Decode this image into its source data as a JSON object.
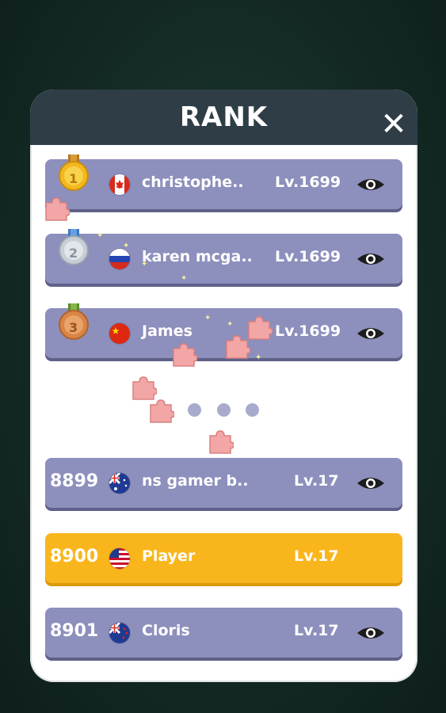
{
  "panel": {
    "title": "RANK"
  },
  "close_glyph": "✕",
  "rows": [
    {
      "rank": "1",
      "medal": "gold",
      "flag": "canada",
      "name": "christophe..",
      "level": "Lv.1699"
    },
    {
      "rank": "2",
      "medal": "silver",
      "flag": "russia",
      "name": "karen mcga..",
      "level": "Lv.1699"
    },
    {
      "rank": "3",
      "medal": "bronze",
      "flag": "china",
      "name": "James",
      "level": "Lv.1699"
    },
    {
      "rank": "8899",
      "flag": "australia",
      "name": "ns gamer b..",
      "level": "Lv.17"
    },
    {
      "rank": "8900",
      "flag": "usa",
      "name": "Player",
      "level": "Lv.17",
      "highlight": true
    },
    {
      "rank": "8901",
      "flag": "new-zealand",
      "name": "Cloris",
      "level": "Lv.17"
    }
  ],
  "colors": {
    "header": "#2f3e46",
    "row": "#8d8fbd",
    "player_row": "#f9b61c",
    "gold": "#f3b81d",
    "silver": "#c8ced6",
    "bronze": "#d98546"
  },
  "icons": [
    "close-icon",
    "eye-icon",
    "medal-icon",
    "flag-icon",
    "puzzle-piece-icon"
  ]
}
